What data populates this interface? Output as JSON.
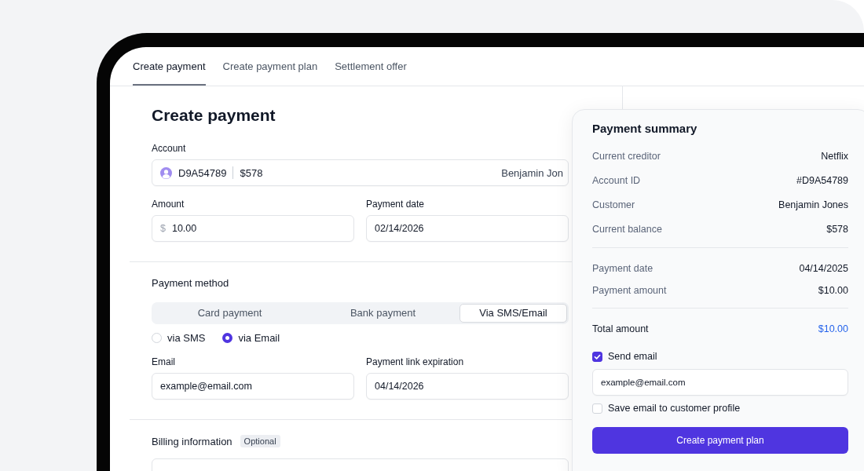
{
  "tabs": [
    {
      "label": "Create payment",
      "selected": true
    },
    {
      "label": "Create payment plan",
      "selected": false
    },
    {
      "label": "Settlement offer",
      "selected": false
    }
  ],
  "form": {
    "title": "Create payment",
    "account": {
      "label": "Account",
      "id": "D9A54789",
      "balance": "$578",
      "customer": "Benjamin Jon"
    },
    "amount": {
      "label": "Amount",
      "prefix": "$",
      "value": "10.00"
    },
    "payment_date": {
      "label": "Payment date",
      "value": "02/14/2026"
    },
    "payment_method": {
      "label": "Payment method",
      "options": [
        {
          "label": "Card payment",
          "selected": false
        },
        {
          "label": "Bank payment",
          "selected": false
        },
        {
          "label": "Via SMS/Email",
          "selected": true
        }
      ],
      "channels": [
        {
          "label": "via SMS",
          "selected": false
        },
        {
          "label": "via Email",
          "selected": true
        }
      ]
    },
    "email": {
      "label": "Email",
      "value": "example@email.com"
    },
    "link_expiration": {
      "label": "Payment link expiration",
      "value": "04/14/2026"
    },
    "billing": {
      "label": "Billing information",
      "badge": "Optional"
    }
  },
  "summary": {
    "title": "Payment summary",
    "groups": [
      [
        {
          "label": "Current creditor",
          "value": "Netflix"
        },
        {
          "label": "Account ID",
          "value": "#D9A54789"
        },
        {
          "label": "Customer",
          "value": "Benjamin Jones"
        },
        {
          "label": "Current balance",
          "value": "$578"
        }
      ],
      [
        {
          "label": "Payment date",
          "value": "04/14/2025"
        },
        {
          "label": "Payment amount",
          "value": "$10.00"
        }
      ]
    ],
    "total": {
      "label": "Total amount",
      "value": "$10.00"
    },
    "send_email": {
      "label": "Send email",
      "checked": true
    },
    "email": {
      "value": "example@email.com"
    },
    "save_email": {
      "label": "Save email to customer profile",
      "checked": false
    },
    "button": "Create payment plan"
  }
}
